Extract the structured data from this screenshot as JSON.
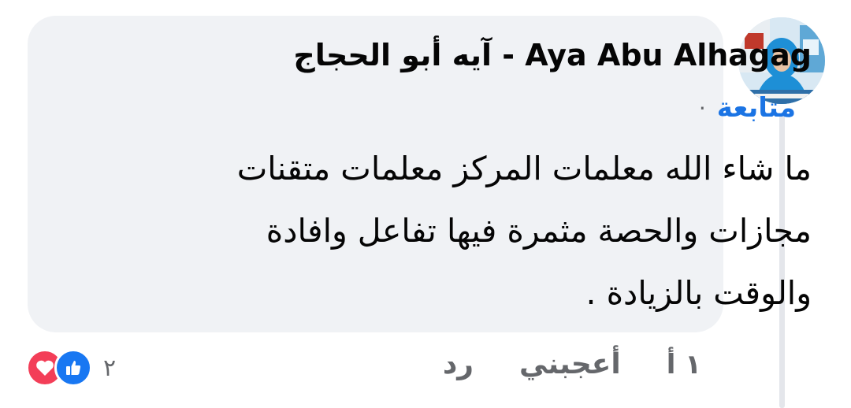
{
  "comment": {
    "author": "آيه أبو الحجاج - Aya Abu Alhagag",
    "follow_dot": "·",
    "follow_label": "متابعة",
    "lines": [
      "ما شاء الله معلمات المركز  معلمات متقنات",
      "مجازات والحصة مثمرة فيها تفاعل وافادة",
      "والوقت بالزيادة ."
    ]
  },
  "actions": {
    "time": "١ أ",
    "like_label": "أعجبني",
    "reply_label": "رد"
  },
  "reactions": {
    "count": "٢",
    "icons": [
      "love-icon",
      "like-icon"
    ]
  },
  "colors": {
    "bubble": "#f0f2f5",
    "link": "#1b74e4",
    "muted": "#65676b",
    "love": "#f33e58",
    "like": "#1877f2"
  }
}
